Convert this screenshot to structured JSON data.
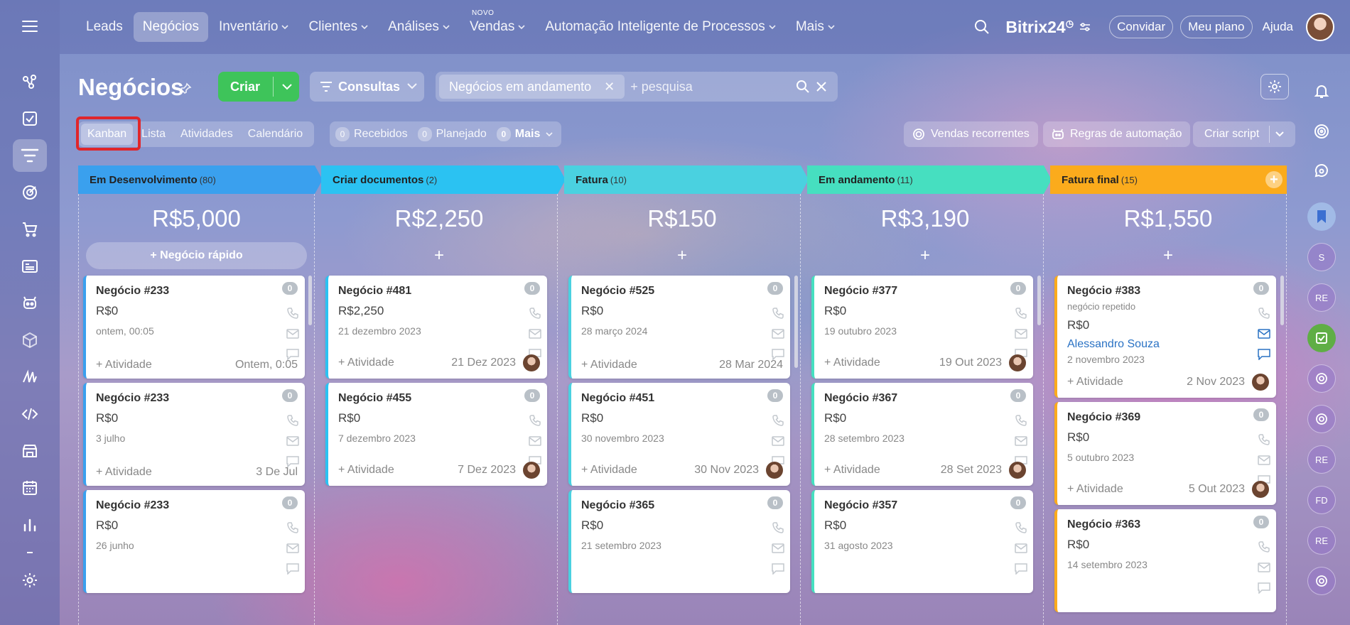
{
  "nav": {
    "items": [
      {
        "label": "Leads",
        "chevron": false,
        "active": false
      },
      {
        "label": "Negócios",
        "chevron": false,
        "active": true
      },
      {
        "label": "Inventário",
        "chevron": true,
        "active": false
      },
      {
        "label": "Clientes",
        "chevron": true,
        "active": false
      },
      {
        "label": "Análises",
        "chevron": true,
        "active": false
      },
      {
        "label": "Vendas",
        "chevron": true,
        "active": false,
        "badge": "NOVO"
      },
      {
        "label": "Automação Inteligente de Processos",
        "chevron": true,
        "active": false
      },
      {
        "label": "Mais",
        "chevron": true,
        "active": false
      }
    ],
    "brand": "Bitrix",
    "brand_num": "24",
    "invite": "Convidar",
    "plan": "Meu plano",
    "help": "Ajuda"
  },
  "header": {
    "title": "Negócios",
    "create": "Criar",
    "queries": "Consultas",
    "filter_chip": "Negócios em andamento",
    "search_placeholder": "+ pesquisa"
  },
  "views": {
    "tabs": [
      {
        "label": "Kanban",
        "active": true
      },
      {
        "label": "Lista",
        "active": false
      },
      {
        "label": "Atividades",
        "active": false
      },
      {
        "label": "Calendário",
        "active": false
      }
    ],
    "counters": [
      {
        "count": "0",
        "label": "Recebidos"
      },
      {
        "count": "0",
        "label": "Planejado"
      },
      {
        "count": "0",
        "label": "Mais"
      }
    ],
    "recurring": "Vendas recorrentes",
    "rules": "Regras de automação",
    "script": "Criar script"
  },
  "colors": {
    "create_green": "#3ec45a",
    "highlight_red": "#e0262b",
    "contact_blue": "#2a72c4"
  },
  "columns": [
    {
      "name": "Em Desenvolvimento",
      "count": "(80)",
      "color": "#3aa0ee",
      "sum": "R$5,000",
      "quick_add": "+ Negócio rápido",
      "has_add_icon": false,
      "cards": [
        {
          "title": "Negócio #233",
          "amount": "R$0",
          "date": "ontem, 00:05",
          "activity": "+ Atividade",
          "foot_date": "Ontem, 0:05",
          "badge": "0",
          "avatar": false
        },
        {
          "title": "Negócio #233",
          "amount": "R$0",
          "date": "3 julho",
          "activity": "+ Atividade",
          "foot_date": "3 De Jul",
          "badge": "0",
          "avatar": false
        },
        {
          "title": "Negócio #233",
          "amount": "R$0",
          "date": "26 junho",
          "badge": "0",
          "avatar": false
        }
      ]
    },
    {
      "name": "Criar documentos",
      "count": "(2)",
      "color": "#2bc2f2",
      "sum": "R$2,250",
      "quick_add": "+",
      "has_add_icon": false,
      "cards": [
        {
          "title": "Negócio #481",
          "amount": "R$2,250",
          "date": "21 dezembro 2023",
          "activity": "+ Atividade",
          "foot_date": "21 Dez 2023",
          "badge": "0",
          "avatar": true
        },
        {
          "title": "Negócio #455",
          "amount": "R$0",
          "date": "7 dezembro 2023",
          "activity": "+ Atividade",
          "foot_date": "7 Dez 2023",
          "badge": "0",
          "avatar": true
        }
      ]
    },
    {
      "name": "Fatura",
      "count": "(10)",
      "color": "#4ad1e0",
      "sum": "R$150",
      "quick_add": "+",
      "has_add_icon": false,
      "cards": [
        {
          "title": "Negócio #525",
          "amount": "R$0",
          "date": "28 março 2024",
          "activity": "+ Atividade",
          "foot_date": "28 Mar 2024",
          "badge": "0",
          "avatar": false
        },
        {
          "title": "Negócio #451",
          "amount": "R$0",
          "date": "30 novembro 2023",
          "activity": "+ Atividade",
          "foot_date": "30 Nov 2023",
          "badge": "0",
          "avatar": true
        },
        {
          "title": "Negócio #365",
          "amount": "R$0",
          "date": "21 setembro 2023",
          "badge": "0",
          "avatar": false
        }
      ]
    },
    {
      "name": "Em andamento",
      "count": "(11)",
      "color": "#46dfc0",
      "sum": "R$3,190",
      "quick_add": "+",
      "has_add_icon": false,
      "cards": [
        {
          "title": "Negócio #377",
          "amount": "R$0",
          "date": "19 outubro 2023",
          "activity": "+ Atividade",
          "foot_date": "19 Out 2023",
          "badge": "0",
          "avatar": true
        },
        {
          "title": "Negócio #367",
          "amount": "R$0",
          "date": "28 setembro 2023",
          "activity": "+ Atividade",
          "foot_date": "28 Set 2023",
          "badge": "0",
          "avatar": true
        },
        {
          "title": "Negócio #357",
          "amount": "R$0",
          "date": "31 agosto 2023",
          "badge": "0",
          "avatar": false
        }
      ]
    },
    {
      "name": "Fatura final",
      "count": "(15)",
      "color": "#fbab1c",
      "sum": "R$1,550",
      "quick_add": "+",
      "has_add_icon": true,
      "cards": [
        {
          "title": "Negócio #383",
          "subtitle": "negócio repetido",
          "amount": "R$0",
          "contact": "Alessandro Souza",
          "date": "2 novembro 2023",
          "activity": "+ Atividade",
          "foot_date": "2 Nov 2023",
          "badge": "0",
          "avatar": true
        },
        {
          "title": "Negócio #369",
          "amount": "R$0",
          "date": "5 outubro 2023",
          "activity": "+ Atividade",
          "foot_date": "5 Out 2023",
          "badge": "0",
          "avatar": true
        },
        {
          "title": "Negócio #363",
          "amount": "R$0",
          "date": "14 setembro 2023",
          "badge": "0",
          "avatar": false
        }
      ]
    }
  ],
  "right_rail": [
    "S",
    "RE",
    "RE",
    "FD",
    "RE"
  ]
}
